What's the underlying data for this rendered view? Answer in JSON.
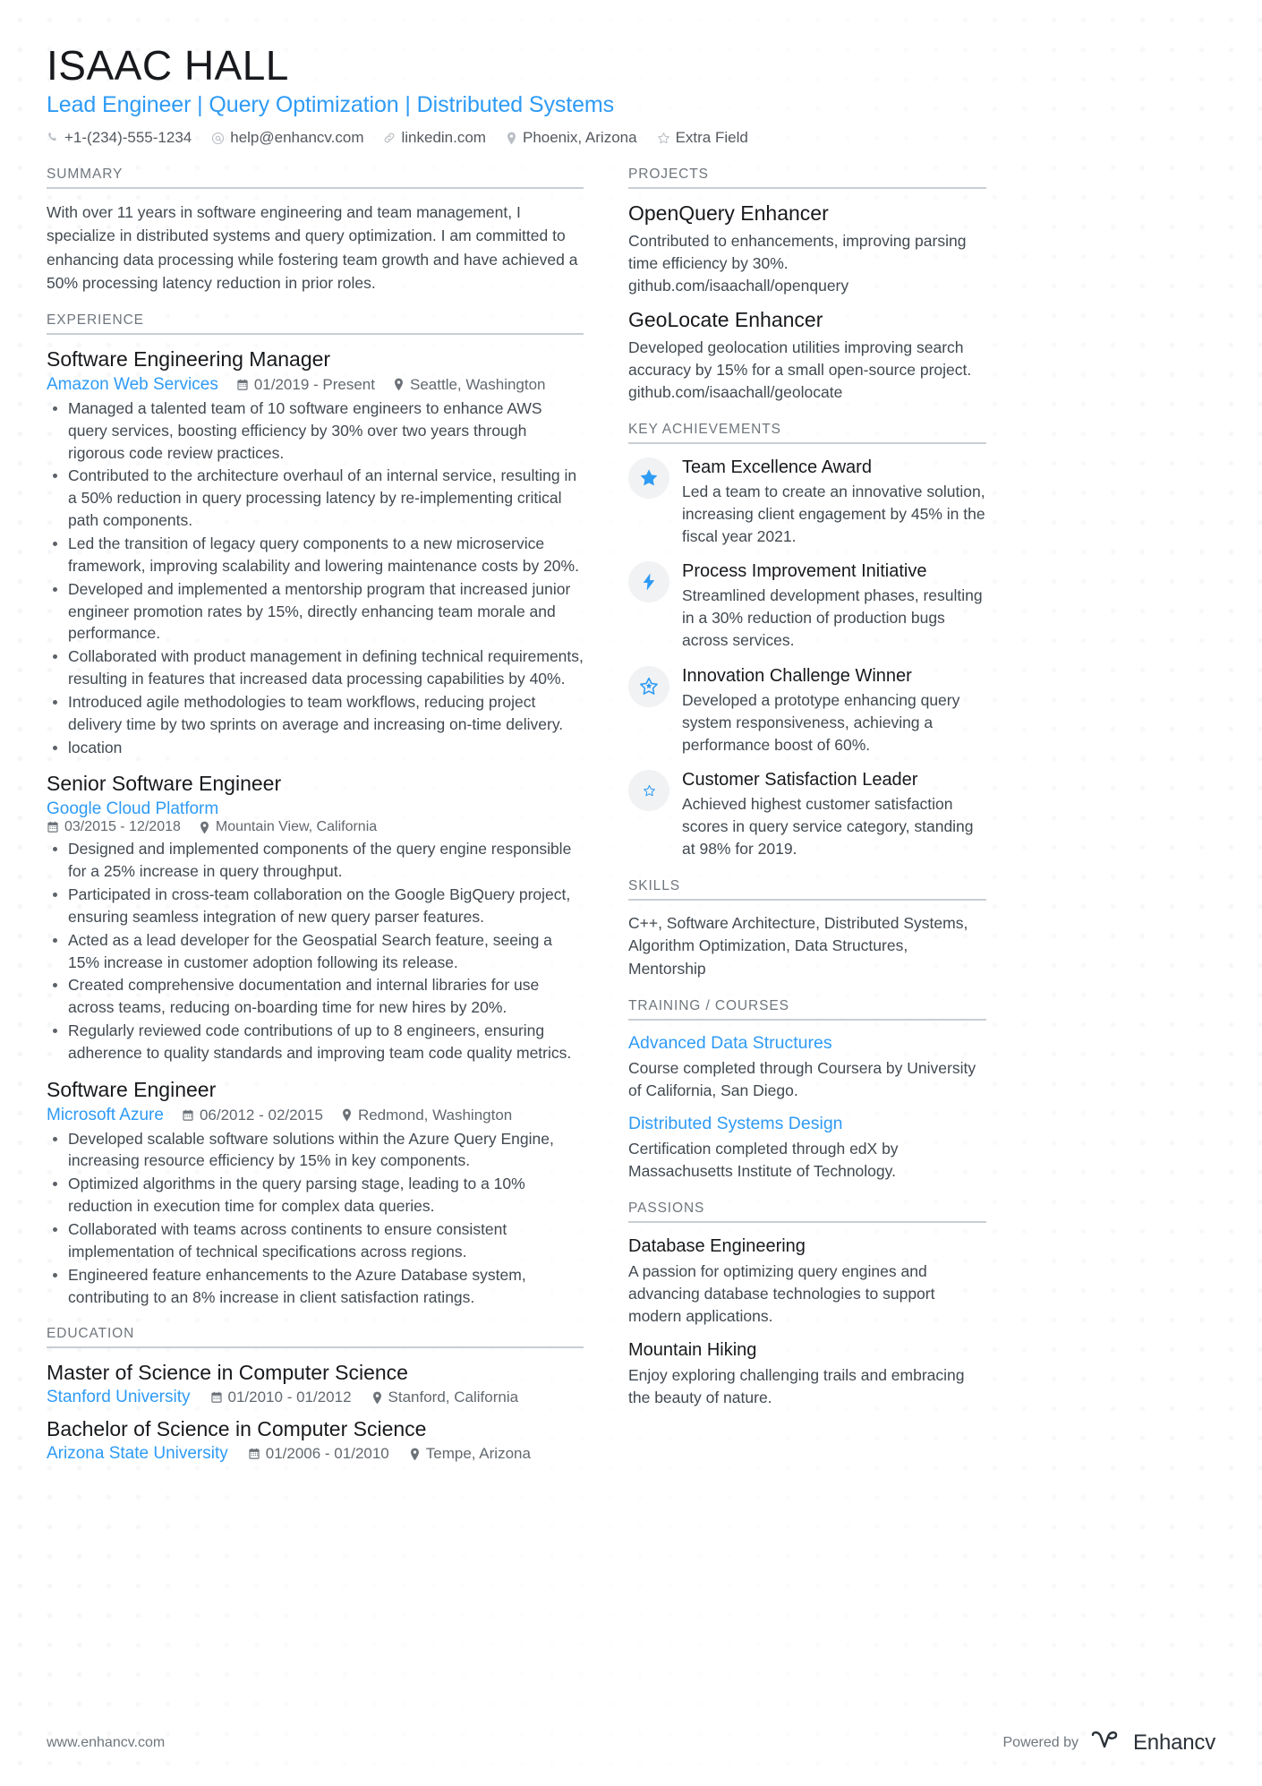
{
  "theme": {
    "accent": "#2e9bf5",
    "text": "#424950",
    "heading": "#17191c",
    "muted": "#6f767d",
    "rule": "#c9ced3"
  },
  "header": {
    "name": "ISAAC HALL",
    "headline": "Lead Engineer | Query Optimization | Distributed Systems",
    "contacts": [
      {
        "icon": "phone-icon",
        "text": "+1-(234)-555-1234"
      },
      {
        "icon": "email-icon",
        "text": "help@enhancv.com"
      },
      {
        "icon": "link-icon",
        "text": "linkedin.com"
      },
      {
        "icon": "location-pin-icon",
        "text": "Phoenix, Arizona"
      },
      {
        "icon": "star-outline-icon",
        "text": "Extra Field"
      }
    ]
  },
  "left": {
    "summary": {
      "title": "SUMMARY",
      "text": "With over 11 years in software engineering and team management, I specialize in distributed systems and query optimization. I am committed to enhancing data processing while fostering team growth and have achieved a 50% processing latency reduction in prior roles."
    },
    "experience": {
      "title": "EXPERIENCE",
      "jobs": [
        {
          "role": "Software Engineering Manager",
          "company": "Amazon Web Services",
          "dates": "01/2019 - Present",
          "location": "Seattle, Washington",
          "layout": "inline",
          "bullets": [
            "Managed a talented team of 10 software engineers to enhance AWS query services, boosting efficiency by 30% over two years through rigorous code review practices.",
            "Contributed to the architecture overhaul of an internal service, resulting in a 50% reduction in query processing latency by re-implementing critical path components.",
            "Led the transition of legacy query components to a new microservice framework, improving scalability and lowering maintenance costs by 20%.",
            "Developed and implemented a mentorship program that increased junior engineer promotion rates by 15%, directly enhancing team morale and performance.",
            "Collaborated with product management in defining technical requirements, resulting in features that increased data processing capabilities by 40%.",
            "Introduced agile methodologies to team workflows, reducing project delivery time by two sprints on average and increasing on-time delivery.",
            "location"
          ]
        },
        {
          "role": "Senior Software Engineer",
          "company": "Google Cloud Platform",
          "dates": "03/2015 - 12/2018",
          "location": "Mountain View, California",
          "layout": "stacked",
          "bullets": [
            "Designed and implemented components of the query engine responsible for a 25% increase in query throughput.",
            "Participated in cross-team collaboration on the Google BigQuery project, ensuring seamless integration of new query parser features.",
            "Acted as a lead developer for the Geospatial Search feature, seeing a 15% increase in customer adoption following its release.",
            "Created comprehensive documentation and internal libraries for use across teams, reducing on-boarding time for new hires by 20%.",
            "Regularly reviewed code contributions of up to 8 engineers, ensuring adherence to quality standards and improving team code quality metrics."
          ]
        },
        {
          "role": "Software Engineer",
          "company": "Microsoft Azure",
          "dates": "06/2012 - 02/2015",
          "location": "Redmond, Washington",
          "layout": "inline",
          "bullets": [
            "Developed scalable software solutions within the Azure Query Engine, increasing resource efficiency by 15% in key components.",
            "Optimized algorithms in the query parsing stage, leading to a 10% reduction in execution time for complex data queries.",
            "Collaborated with teams across continents to ensure consistent implementation of technical specifications across regions.",
            "Engineered feature enhancements to the Azure Database system, contributing to an 8% increase in client satisfaction ratings."
          ]
        }
      ]
    },
    "education": {
      "title": "EDUCATION",
      "items": [
        {
          "degree": "Master of Science in Computer Science",
          "school": "Stanford University",
          "dates": "01/2010 - 01/2012",
          "location": "Stanford, California"
        },
        {
          "degree": "Bachelor of Science in Computer Science",
          "school": "Arizona State University",
          "dates": "01/2006 - 01/2010",
          "location": "Tempe, Arizona"
        }
      ]
    }
  },
  "right": {
    "projects": {
      "title": "PROJECTS",
      "items": [
        {
          "name": "OpenQuery Enhancer",
          "description": "Contributed to enhancements, improving parsing time efficiency by 30%. github.com/isaachall/openquery"
        },
        {
          "name": "GeoLocate Enhancer",
          "description": "Developed geolocation utilities improving search accuracy by 15% for a small open-source project. github.com/isaachall/geolocate"
        }
      ]
    },
    "achievements": {
      "title": "KEY ACHIEVEMENTS",
      "items": [
        {
          "icon": "star-filled-icon",
          "title": "Team Excellence Award",
          "description": "Led a team to create an innovative solution, increasing client engagement by 45% in the fiscal year 2021."
        },
        {
          "icon": "lightning-bolt-icon",
          "title": "Process Improvement Initiative",
          "description": "Streamlined development phases, resulting in a 30% reduction of production bugs across services."
        },
        {
          "icon": "star-badge-icon",
          "title": "Innovation Challenge Winner",
          "description": "Developed a prototype enhancing query system responsiveness, achieving a performance boost of 60%."
        },
        {
          "icon": "star-outline-icon",
          "title": "Customer Satisfaction Leader",
          "description": "Achieved highest customer satisfaction scores in query service category, standing at 98% for 2019."
        }
      ]
    },
    "skills": {
      "title": "SKILLS",
      "text": "C++, Software Architecture, Distributed Systems, Algorithm Optimization, Data Structures, Mentorship"
    },
    "training": {
      "title": "TRAINING / COURSES",
      "items": [
        {
          "name": "Advanced Data Structures",
          "description": "Course completed through Coursera by University of California, San Diego."
        },
        {
          "name": "Distributed Systems Design",
          "description": "Certification completed through edX by Massachusetts Institute of Technology."
        }
      ]
    },
    "passions": {
      "title": "PASSIONS",
      "items": [
        {
          "name": "Database Engineering",
          "description": "A passion for optimizing query engines and advancing database technologies to support modern applications."
        },
        {
          "name": "Mountain Hiking",
          "description": "Enjoy exploring challenging trails and embracing the beauty of nature."
        }
      ]
    }
  },
  "footer": {
    "url": "www.enhancv.com",
    "powered_by": "Powered by",
    "brand": "Enhancv"
  }
}
